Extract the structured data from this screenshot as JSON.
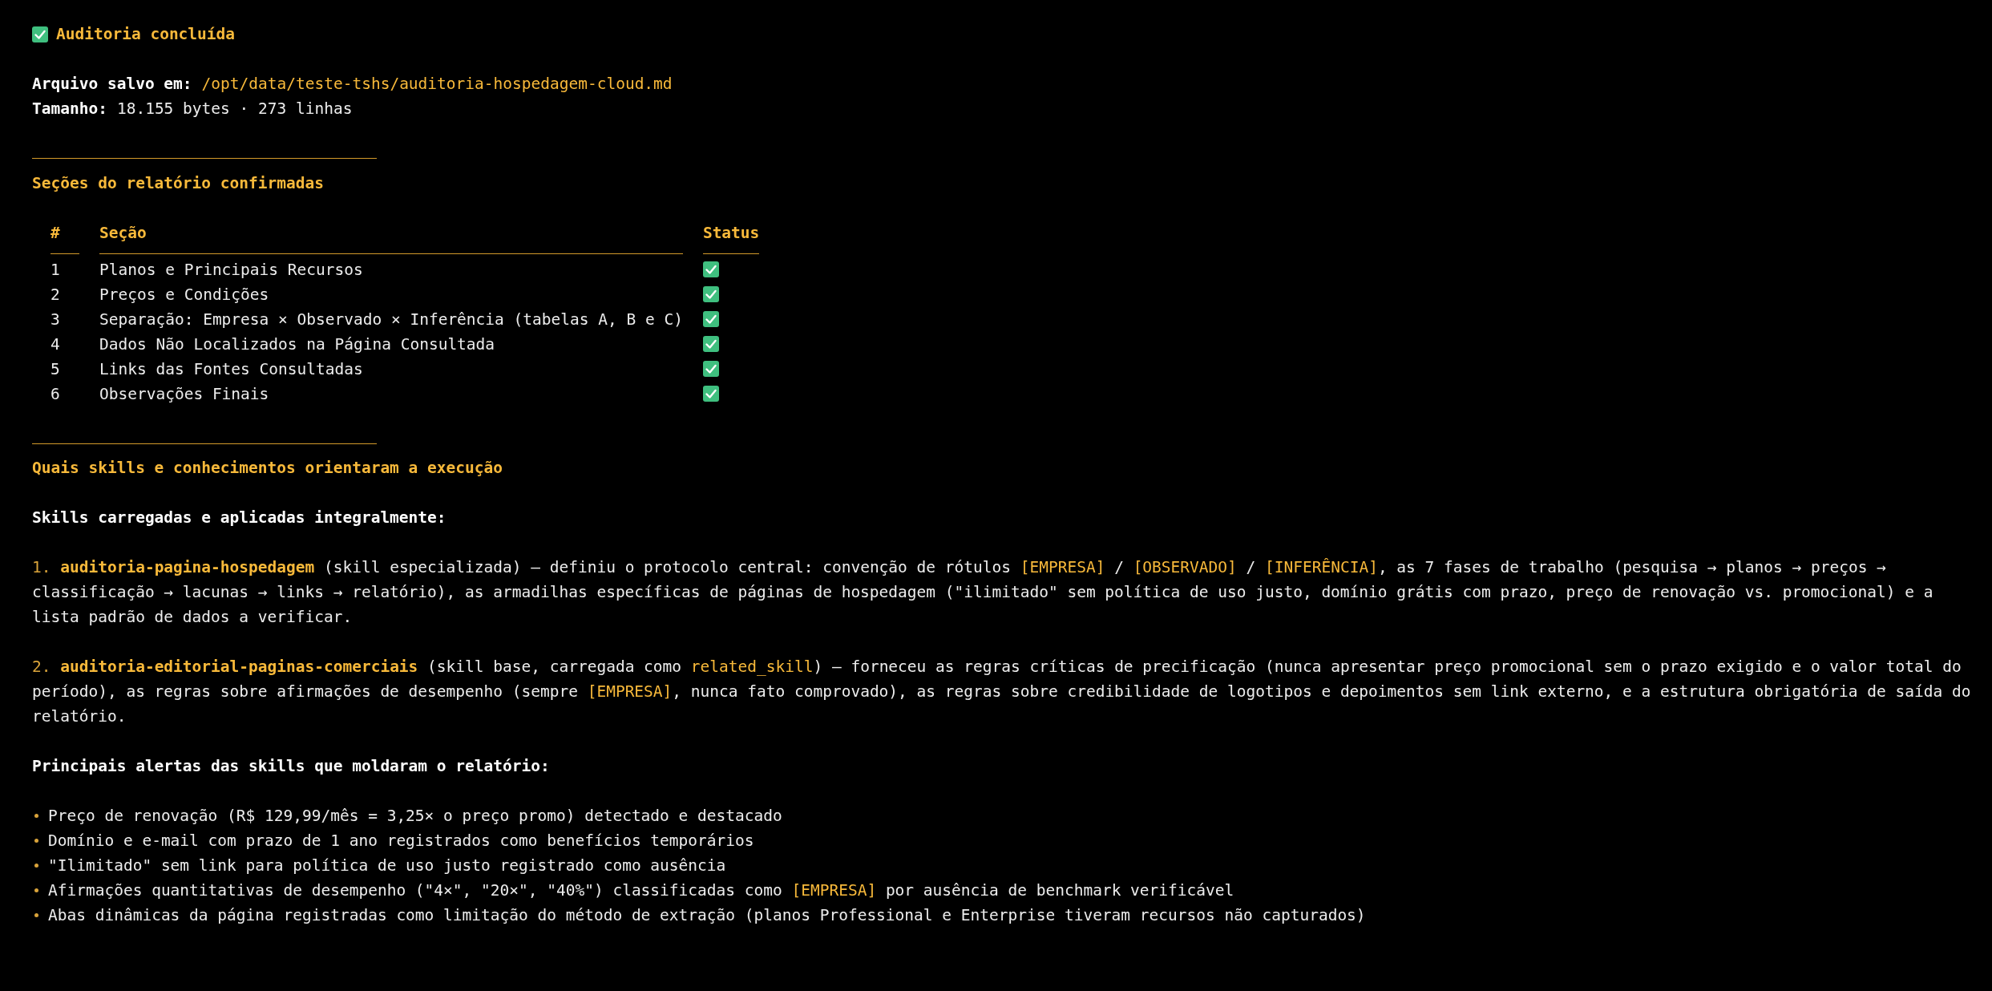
{
  "title": {
    "text": "Auditoria concluída",
    "checked": true
  },
  "file_info": [
    {
      "label": "Arquivo salvo em:",
      "value": "/opt/data/teste-tshs/auditoria-hospedagem-cloud.md",
      "highlight": true
    },
    {
      "label": "Tamanho:",
      "value": "18.155 bytes · 273 linhas",
      "highlight": false
    }
  ],
  "sections_heading": "Seções do relatório confirmadas",
  "sections_table": {
    "columns": [
      "#",
      "Seção",
      "Status"
    ],
    "rows": [
      {
        "number": "1",
        "section": "Planos e Principais Recursos",
        "checked": true
      },
      {
        "number": "2",
        "section": "Preços e Condições",
        "checked": true
      },
      {
        "number": "3",
        "section": "Separação: Empresa × Observado × Inferência (tabelas A, B e C)",
        "checked": true
      },
      {
        "number": "4",
        "section": "Dados Não Localizados na Página Consultada",
        "checked": true
      },
      {
        "number": "5",
        "section": "Links das Fontes Consultadas",
        "checked": true
      },
      {
        "number": "6",
        "section": "Observações Finais",
        "checked": true
      }
    ]
  },
  "skills_heading": "Quais skills e conhecimentos orientaram a execução",
  "skills_subheading": "Skills carregadas e aplicadas integralmente:",
  "skills": [
    {
      "segments": [
        {
          "kind": "number",
          "text": "1. "
        },
        {
          "kind": "skill",
          "text": "auditoria-pagina-hospedagem"
        },
        {
          "kind": "text",
          "text": " (skill especializada) — definiu o protocolo central: convenção de rótulos "
        },
        {
          "kind": "tag",
          "text": "[EMPRESA]"
        },
        {
          "kind": "text",
          "text": " / "
        },
        {
          "kind": "tag",
          "text": "[OBSERVADO]"
        },
        {
          "kind": "text",
          "text": " / "
        },
        {
          "kind": "tag",
          "text": "[INFERÊNCIA]"
        },
        {
          "kind": "text",
          "text": ", as 7 fases de trabalho (pesquisa → planos → preços → classificação → lacunas → links → relatório), as armadilhas específicas de páginas de hospedagem (\"ilimitado\" sem política de uso justo, domínio grátis com prazo, preço de renovação vs. promocional) e a lista padrão de dados a verificar."
        }
      ]
    },
    {
      "segments": [
        {
          "kind": "number",
          "text": "2. "
        },
        {
          "kind": "skill",
          "text": "auditoria-editorial-paginas-comerciais"
        },
        {
          "kind": "text",
          "text": " (skill base, carregada como "
        },
        {
          "kind": "tag",
          "text": "related_skill"
        },
        {
          "kind": "text",
          "text": ") — forneceu as regras críticas de precificação (nunca apresentar preço promocional sem o prazo exigido e o valor total do período), as regras sobre afirmações de desempenho (sempre "
        },
        {
          "kind": "tag",
          "text": "[EMPRESA]"
        },
        {
          "kind": "text",
          "text": ", nunca fato comprovado), as regras sobre credibilidade de logotipos e depoimentos sem link externo, e a estrutura obrigatória de saída do relatório."
        }
      ]
    }
  ],
  "alerts_heading": "Principais alertas das skills que moldaram o relatório:",
  "alerts": [
    {
      "segments": [
        {
          "kind": "text",
          "text": "Preço de renovação (R$ 129,99/mês = 3,25× o preço promo) detectado e destacado"
        }
      ]
    },
    {
      "segments": [
        {
          "kind": "text",
          "text": "Domínio e e-mail com prazo de 1 ano registrados como benefícios temporários"
        }
      ]
    },
    {
      "segments": [
        {
          "kind": "text",
          "text": "\"Ilimitado\" sem link para política de uso justo registrado como ausência"
        }
      ]
    },
    {
      "segments": [
        {
          "kind": "text",
          "text": "Afirmações quantitativas de desempenho (\"4×\", \"20×\", \"40%\") classificadas como "
        },
        {
          "kind": "tag",
          "text": "[EMPRESA]"
        },
        {
          "kind": "text",
          "text": " por ausência de benchmark verificável"
        }
      ]
    },
    {
      "segments": [
        {
          "kind": "text",
          "text": "Abas dinâmicas da página registradas como limitação do método de extração (planos Professional e Enterprise tiveram recursos não capturados)"
        }
      ]
    }
  ]
}
